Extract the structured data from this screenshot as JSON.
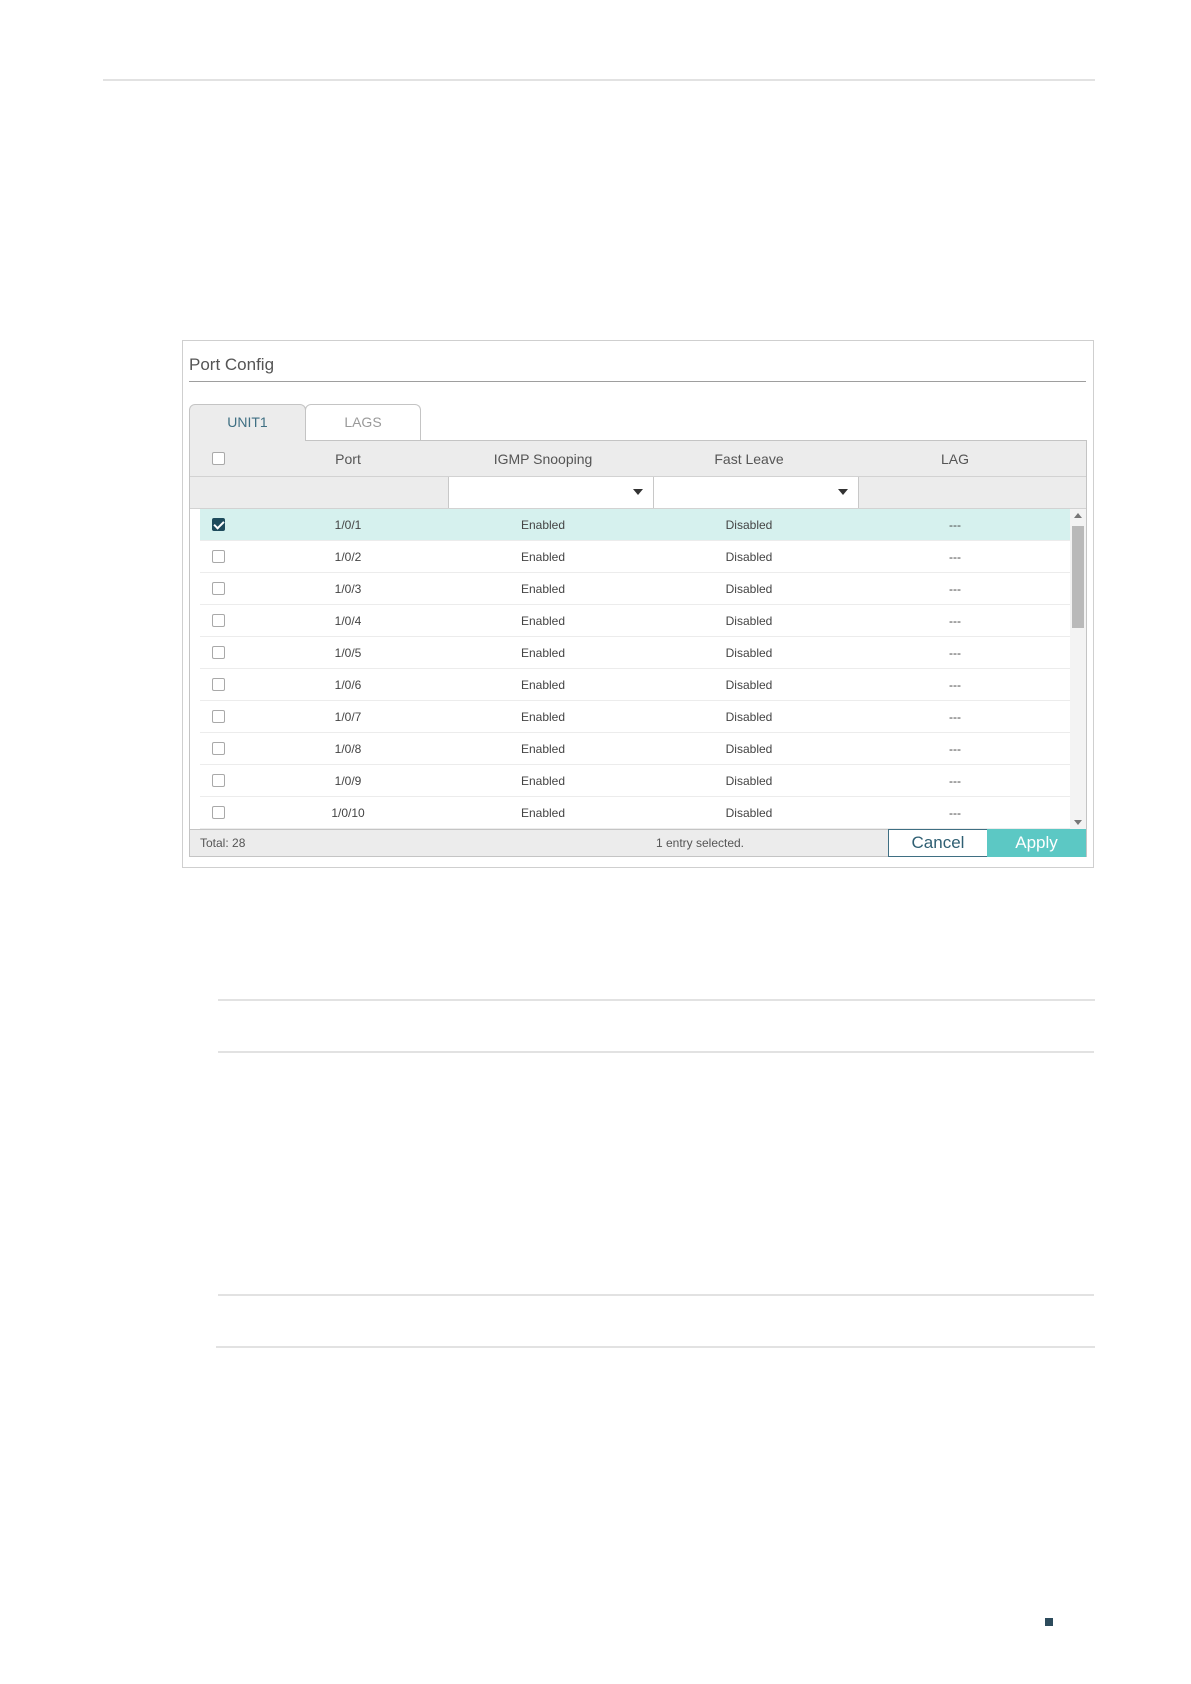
{
  "panel": {
    "title": "Port Config",
    "tabs": [
      {
        "label": "UNIT1",
        "active": true
      },
      {
        "label": "LAGS",
        "active": false
      }
    ],
    "columns": {
      "port": "Port",
      "igmp": "IGMP Snooping",
      "fast_leave": "Fast Leave",
      "lag": "LAG"
    },
    "filters": {
      "igmp": "",
      "fast_leave": ""
    },
    "rows": [
      {
        "port": "1/0/1",
        "igmp": "Enabled",
        "fast_leave": "Disabled",
        "lag": "---",
        "checked": true
      },
      {
        "port": "1/0/2",
        "igmp": "Enabled",
        "fast_leave": "Disabled",
        "lag": "---",
        "checked": false
      },
      {
        "port": "1/0/3",
        "igmp": "Enabled",
        "fast_leave": "Disabled",
        "lag": "---",
        "checked": false
      },
      {
        "port": "1/0/4",
        "igmp": "Enabled",
        "fast_leave": "Disabled",
        "lag": "---",
        "checked": false
      },
      {
        "port": "1/0/5",
        "igmp": "Enabled",
        "fast_leave": "Disabled",
        "lag": "---",
        "checked": false
      },
      {
        "port": "1/0/6",
        "igmp": "Enabled",
        "fast_leave": "Disabled",
        "lag": "---",
        "checked": false
      },
      {
        "port": "1/0/7",
        "igmp": "Enabled",
        "fast_leave": "Disabled",
        "lag": "---",
        "checked": false
      },
      {
        "port": "1/0/8",
        "igmp": "Enabled",
        "fast_leave": "Disabled",
        "lag": "---",
        "checked": false
      },
      {
        "port": "1/0/9",
        "igmp": "Enabled",
        "fast_leave": "Disabled",
        "lag": "---",
        "checked": false
      },
      {
        "port": "1/0/10",
        "igmp": "Enabled",
        "fast_leave": "Disabled",
        "lag": "---",
        "checked": false
      }
    ],
    "footer": {
      "total": "Total: 28",
      "selected": "1 entry selected.",
      "cancel_label": "Cancel",
      "apply_label": "Apply"
    }
  },
  "colors": {
    "accent": "#5cc8c4",
    "selected_row": "#d6f1ee",
    "checkbox_checked": "#1e4b5c"
  }
}
